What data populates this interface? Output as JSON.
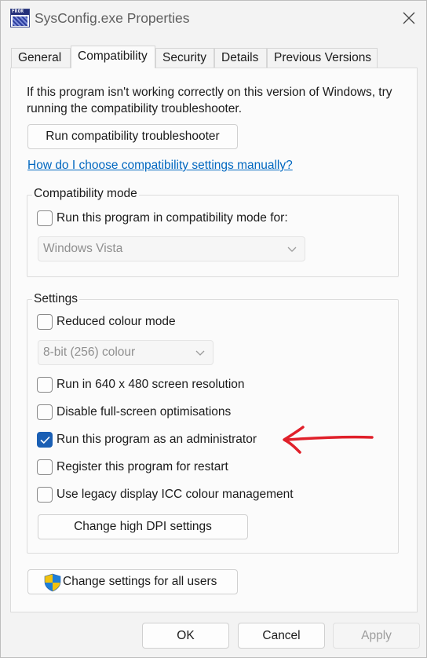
{
  "window": {
    "title": "SysConfig.exe Properties",
    "icon_text": "FROR",
    "icons": {
      "app": "app-icon",
      "close": "close-icon"
    }
  },
  "tabs": [
    {
      "label": "General",
      "active": false
    },
    {
      "label": "Compatibility",
      "active": true
    },
    {
      "label": "Security",
      "active": false
    },
    {
      "label": "Details",
      "active": false
    },
    {
      "label": "Previous Versions",
      "active": false
    }
  ],
  "compat": {
    "intro": "If this program isn't working correctly on this version of Windows, try running the compatibility troubleshooter.",
    "troubleshooter_button": "Run compatibility troubleshooter",
    "help_link": "How do I choose compatibility settings manually?",
    "mode_group": {
      "title": "Compatibility mode",
      "checkbox_label": "Run this program in compatibility mode for:",
      "checked": false,
      "select_value": "Windows Vista"
    },
    "settings_group": {
      "title": "Settings",
      "reduced_colour": {
        "label": "Reduced colour mode",
        "checked": false
      },
      "colour_select_value": "8-bit (256) colour",
      "res_640": {
        "label": "Run in 640 x 480 screen resolution",
        "checked": false
      },
      "disable_fullscreen": {
        "label": "Disable full-screen optimisations",
        "checked": false
      },
      "run_as_admin": {
        "label": "Run this program as an administrator",
        "checked": true
      },
      "register_restart": {
        "label": "Register this program for restart",
        "checked": false
      },
      "legacy_icc": {
        "label": "Use legacy display ICC colour management",
        "checked": false
      },
      "high_dpi_button": "Change high DPI settings"
    },
    "all_users_button": "Change settings for all users",
    "all_users_icon": "uac-shield-icon"
  },
  "footer": {
    "ok": "OK",
    "cancel": "Cancel",
    "apply": "Apply",
    "apply_enabled": false
  },
  "colors": {
    "accent": "#1a5fb4",
    "link": "#0067c0",
    "annotation_arrow": "#e0202a"
  }
}
